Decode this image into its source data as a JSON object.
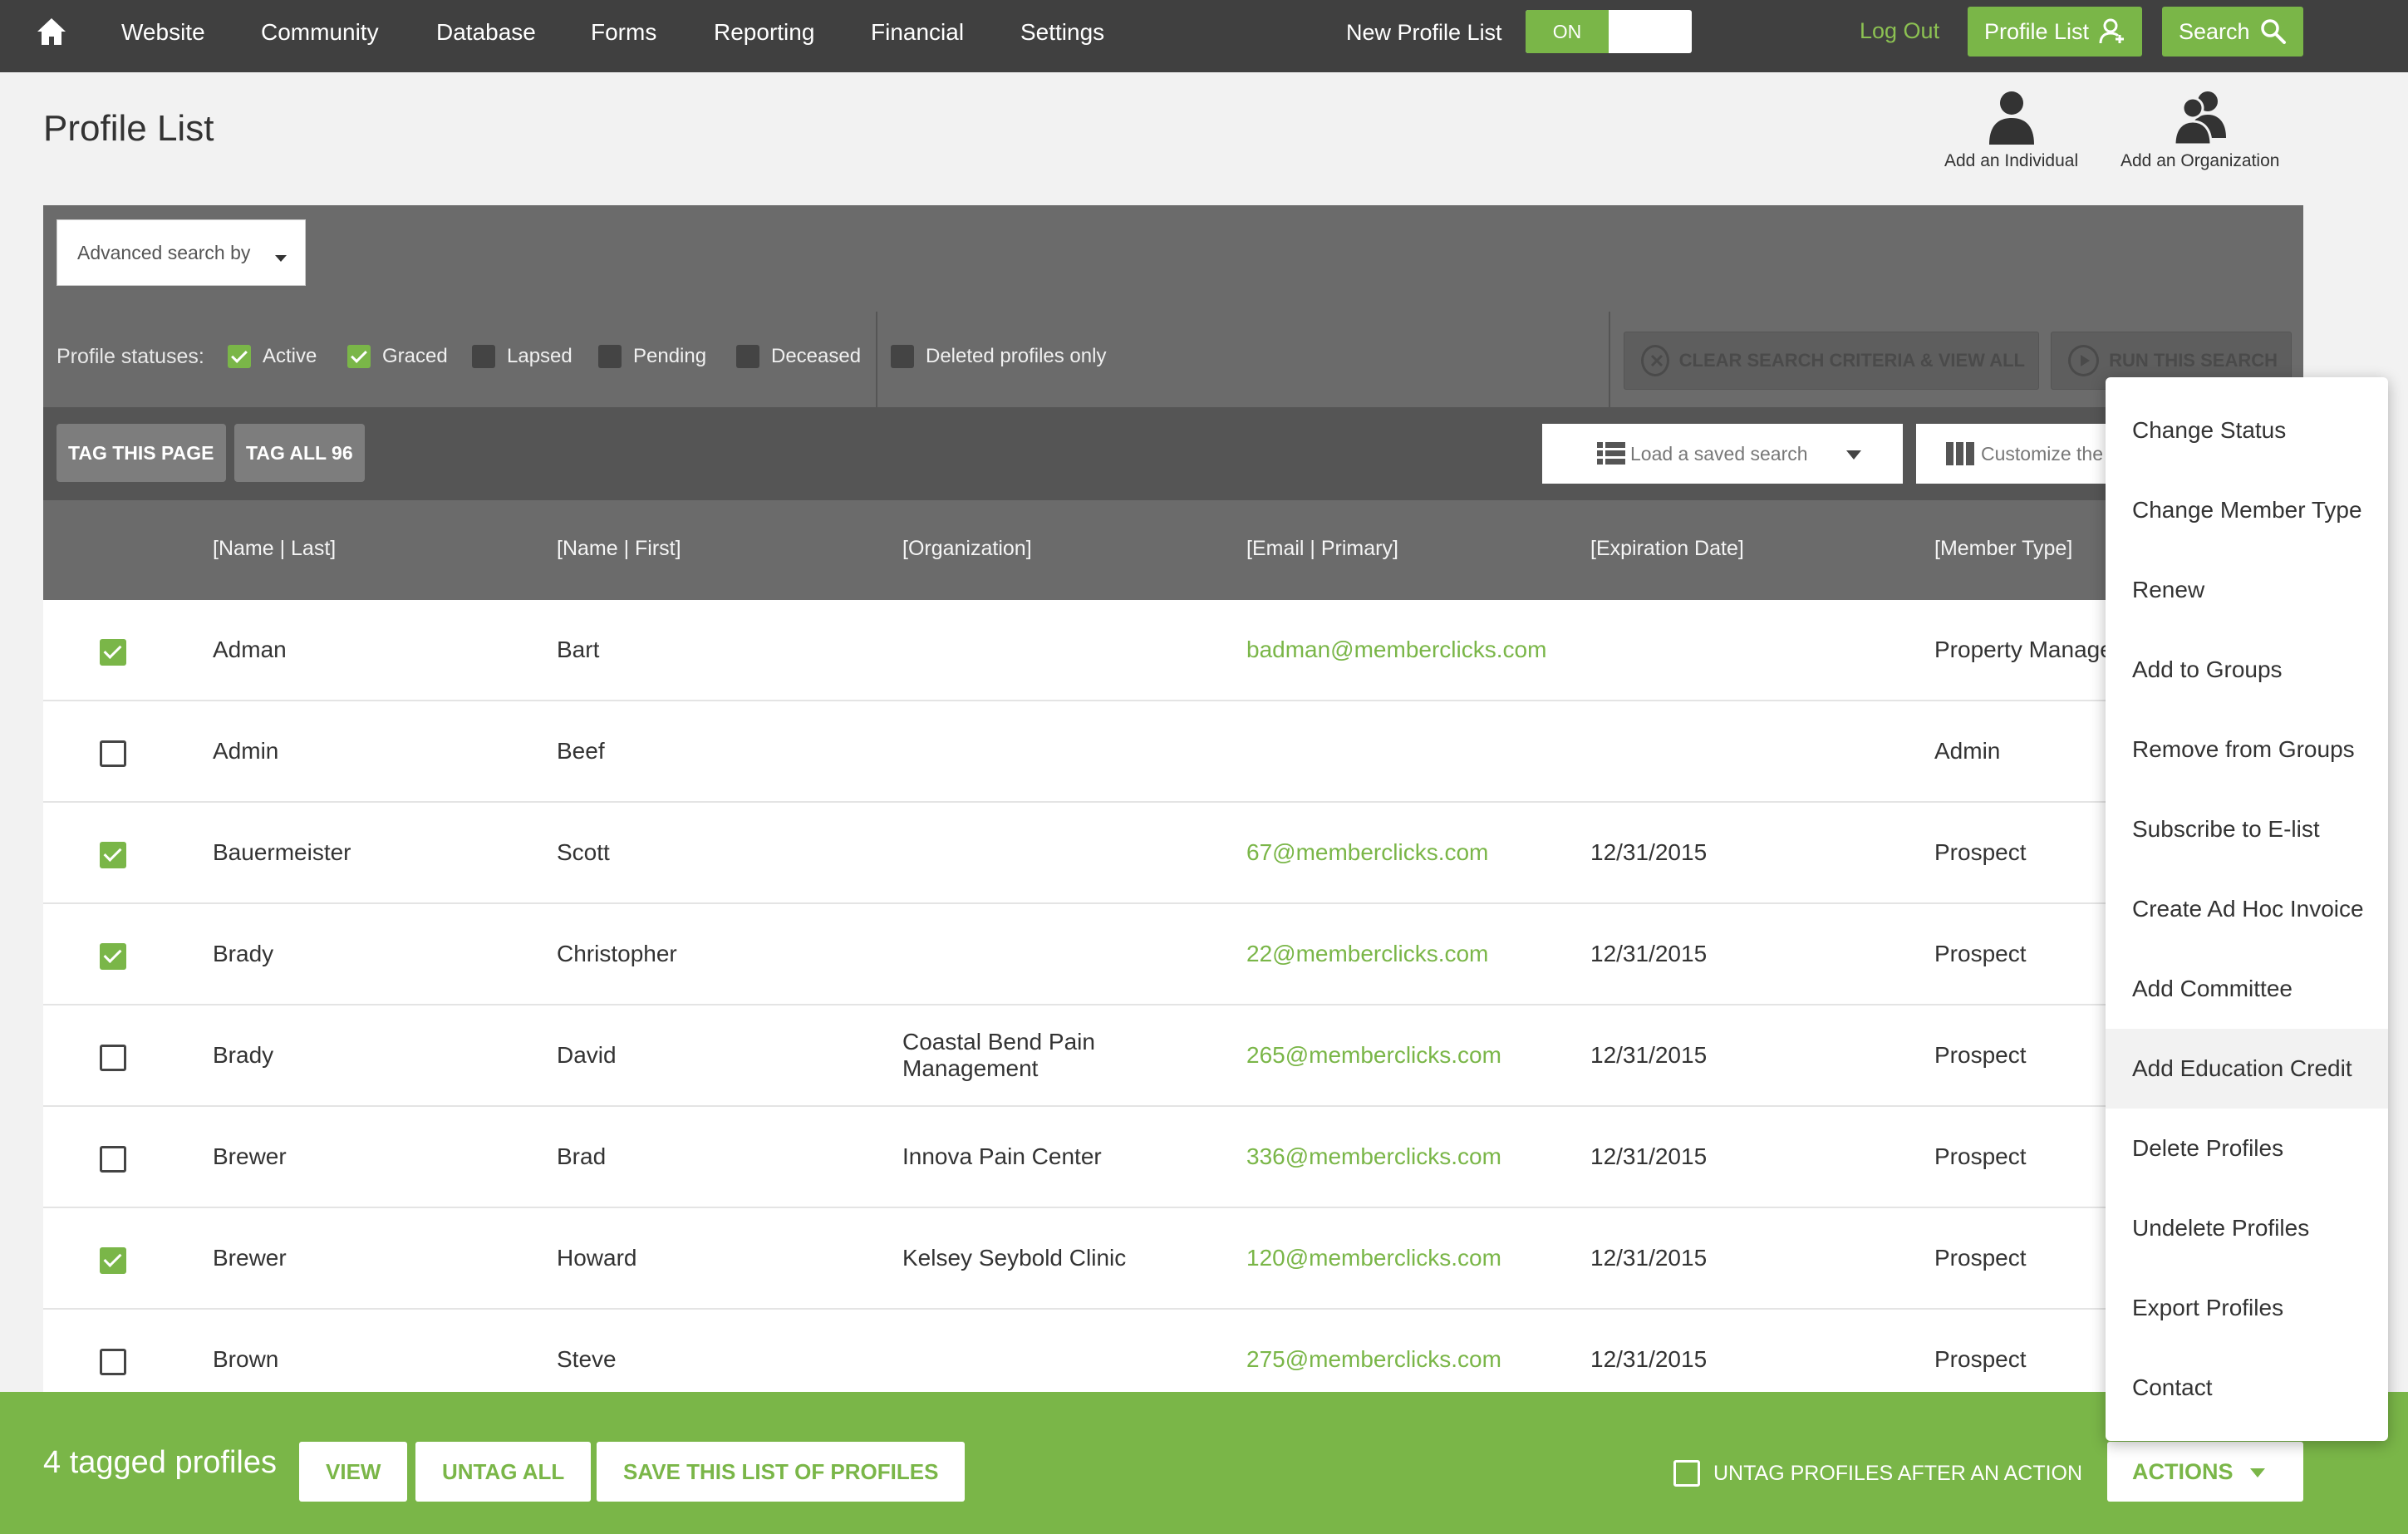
{
  "nav": {
    "items": [
      "Website",
      "Community",
      "Database",
      "Forms",
      "Reporting",
      "Financial",
      "Settings"
    ],
    "new_profile_list_label": "New Profile List",
    "toggle_state": "ON",
    "logout": "Log Out",
    "profile_list_button": "Profile List",
    "search_button": "Search"
  },
  "page": {
    "title": "Profile List",
    "add_individual": "Add an Individual",
    "add_organization": "Add an Organization"
  },
  "search_panel": {
    "advanced_search_placeholder": "Advanced search by",
    "statuses_label": "Profile statuses:",
    "statuses": [
      {
        "label": "Active",
        "checked": true
      },
      {
        "label": "Graced",
        "checked": true
      },
      {
        "label": "Lapsed",
        "checked": false
      },
      {
        "label": "Pending",
        "checked": false
      },
      {
        "label": "Deceased",
        "checked": false
      }
    ],
    "deleted_only": {
      "label": "Deleted profiles only",
      "checked": false
    },
    "clear_button": "CLEAR SEARCH CRITERIA & VIEW ALL",
    "run_button": "RUN THIS SEARCH"
  },
  "toolbar": {
    "tag_page": "TAG THIS PAGE",
    "tag_all": "TAG ALL 96",
    "load_saved_search": "Load a saved search",
    "customize": "Customize the"
  },
  "table": {
    "columns": [
      "[Name | Last]",
      "[Name | First]",
      "[Organization]",
      "[Email | Primary]",
      "[Expiration Date]",
      "[Member Type]"
    ],
    "rows": [
      {
        "checked": true,
        "last": "Adman",
        "first": "Bart",
        "org": "",
        "email": "badman@memberclicks.com",
        "exp": "",
        "type": "Property Manage"
      },
      {
        "checked": false,
        "last": "Admin",
        "first": "Beef",
        "org": "",
        "email": "",
        "exp": "",
        "type": "Admin"
      },
      {
        "checked": true,
        "last": "Bauermeister",
        "first": "Scott",
        "org": "",
        "email": "67@memberclicks.com",
        "exp": "12/31/2015",
        "type": "Prospect"
      },
      {
        "checked": true,
        "last": "Brady",
        "first": "Christopher",
        "org": "",
        "email": "22@memberclicks.com",
        "exp": "12/31/2015",
        "type": "Prospect"
      },
      {
        "checked": false,
        "last": "Brady",
        "first": "David",
        "org": "Coastal Bend Pain Management",
        "email": "265@memberclicks.com",
        "exp": "12/31/2015",
        "type": "Prospect"
      },
      {
        "checked": false,
        "last": "Brewer",
        "first": "Brad",
        "org": "Innova Pain Center",
        "email": "336@memberclicks.com",
        "exp": "12/31/2015",
        "type": "Prospect"
      },
      {
        "checked": true,
        "last": "Brewer",
        "first": "Howard",
        "org": "Kelsey Seybold Clinic",
        "email": "120@memberclicks.com",
        "exp": "12/31/2015",
        "type": "Prospect"
      },
      {
        "checked": false,
        "last": "Brown",
        "first": "Steve",
        "org": "",
        "email": "275@memberclicks.com",
        "exp": "12/31/2015",
        "type": "Prospect"
      }
    ]
  },
  "bottom_bar": {
    "tagged_count": "4 tagged profiles",
    "view": "VIEW",
    "untag_all": "UNTAG ALL",
    "save_list": "SAVE THIS LIST OF PROFILES",
    "untag_after_action": "UNTAG PROFILES AFTER AN ACTION",
    "actions": "ACTIONS"
  },
  "actions_menu": {
    "items": [
      "Change Status",
      "Change Member Type",
      "Renew",
      "Add to Groups",
      "Remove from Groups",
      "Subscribe to E-list",
      "Create Ad Hoc Invoice",
      "Add Committee",
      "Add Education Credit",
      "Delete Profiles",
      "Undelete Profiles",
      "Export Profiles",
      "Contact"
    ],
    "highlighted": "Add Education Credit"
  },
  "colors": {
    "accent": "#7ab648",
    "nav_bg": "#404040",
    "panel_bg": "#6b6b6b"
  },
  "icons": [
    "home-icon",
    "user-add-icon",
    "search-icon",
    "person-icon",
    "group-icon",
    "list-icon",
    "columns-icon",
    "close-circle-icon",
    "play-circle-icon",
    "chevron-down-icon"
  ]
}
